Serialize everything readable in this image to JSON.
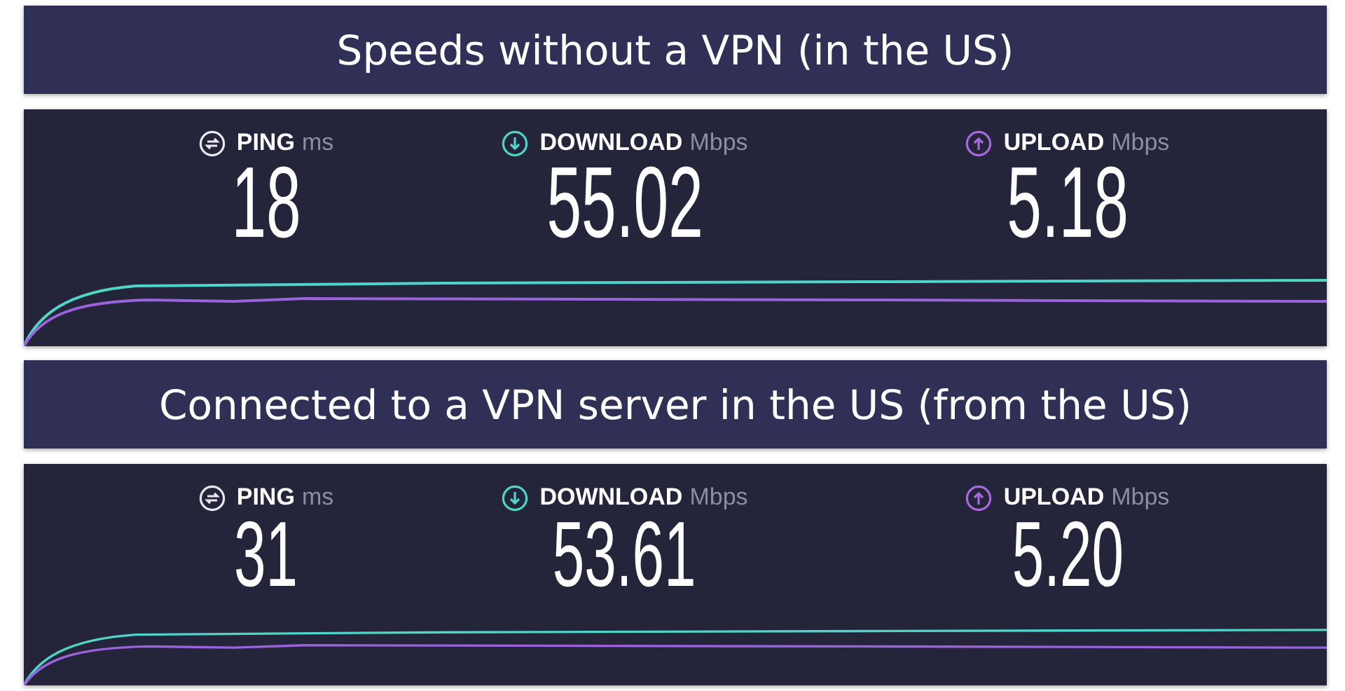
{
  "sections": [
    {
      "title": "Speeds without a VPN (in the US)",
      "metrics": [
        {
          "kind": "ping",
          "label": "PING",
          "unit": "ms",
          "value": "18"
        },
        {
          "kind": "download",
          "label": "DOWNLOAD",
          "unit": "Mbps",
          "value": "55.02"
        },
        {
          "kind": "upload",
          "label": "UPLOAD",
          "unit": "Mbps",
          "value": "5.18"
        }
      ]
    },
    {
      "title": "Connected to a VPN server in the US (from the US)",
      "metrics": [
        {
          "kind": "ping",
          "label": "PING",
          "unit": "ms",
          "value": "31"
        },
        {
          "kind": "download",
          "label": "DOWNLOAD",
          "unit": "Mbps",
          "value": "53.61"
        },
        {
          "kind": "upload",
          "label": "UPLOAD",
          "unit": "Mbps",
          "value": "5.20"
        }
      ]
    }
  ]
}
